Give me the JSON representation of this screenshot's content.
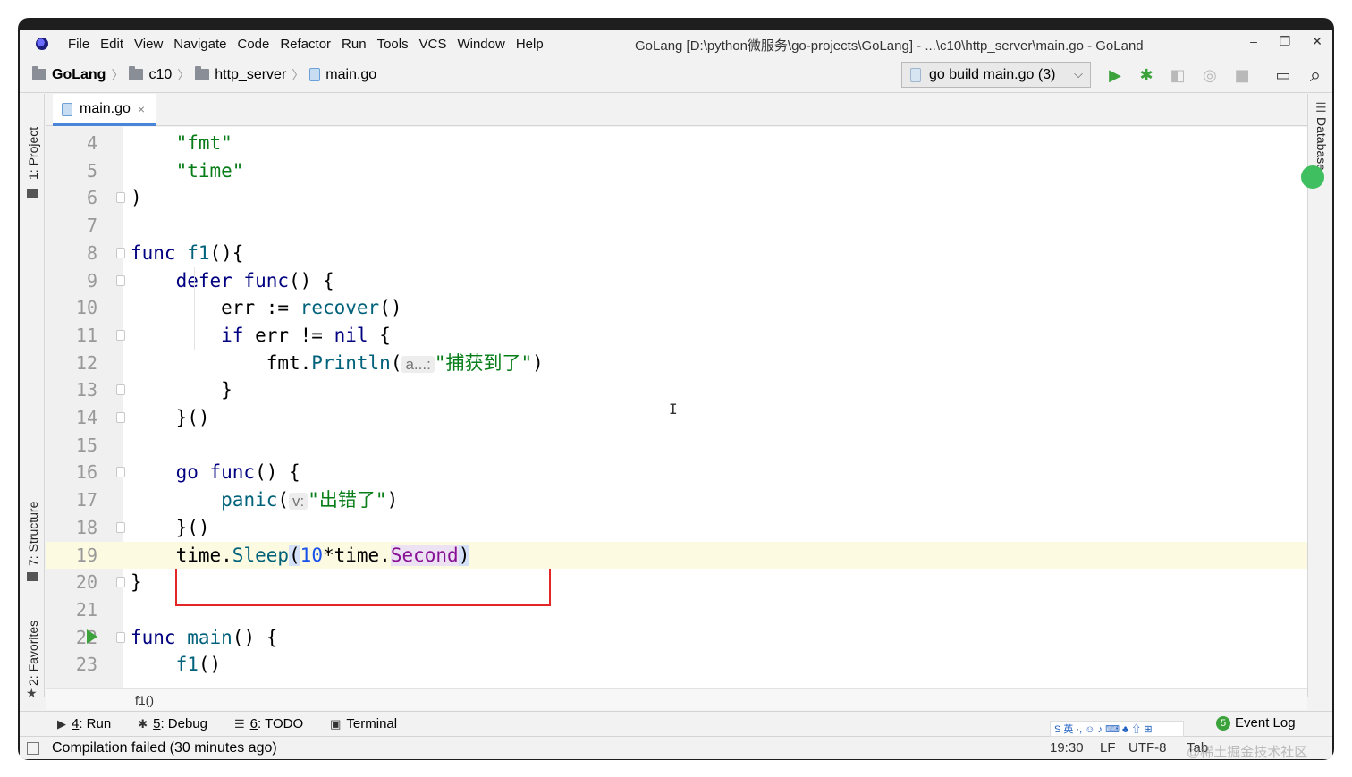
{
  "window": {
    "title": "GoLang [D:\\python微服务\\go-projects\\GoLang] - ...\\c10\\http_server\\main.go - GoLand",
    "minimize": "–",
    "maximize": "❐",
    "close": "✕"
  },
  "menu": [
    "File",
    "Edit",
    "View",
    "Navigate",
    "Code",
    "Refactor",
    "Run",
    "Tools",
    "VCS",
    "Window",
    "Help"
  ],
  "breadcrumbs": [
    {
      "label": "GoLang",
      "icon": "folder-icon"
    },
    {
      "label": "c10",
      "icon": "folder-icon"
    },
    {
      "label": "http_server",
      "icon": "folder-icon"
    },
    {
      "label": "main.go",
      "icon": "go-file-icon"
    }
  ],
  "run_config": {
    "label": "go build main.go (3)"
  },
  "toolbar_icons": {
    "run": "▶",
    "debug": "✱",
    "coverage": "◧",
    "profile": "◎",
    "stop": "■",
    "terminal_toggle": "▭",
    "search": "⌕"
  },
  "colors": {
    "run": "#3ca23c",
    "debug": "#3ca23c",
    "disabled": "#b9b9b9",
    "highlight_box": "#e32626"
  },
  "left_tools": {
    "project": "1: Project",
    "structure": "7: Structure",
    "favorites": "2: Favorites"
  },
  "right_tools": {
    "database": "Database"
  },
  "editor_tab": {
    "label": "main.go",
    "close": "×"
  },
  "code_lines": [
    {
      "n": "4",
      "parts": [
        [
          "pad",
          "    "
        ],
        [
          "str",
          "\"fmt\""
        ]
      ]
    },
    {
      "n": "5",
      "parts": [
        [
          "pad",
          "    "
        ],
        [
          "str",
          "\"time\""
        ]
      ]
    },
    {
      "n": "6",
      "parts": [
        [
          "pkg",
          ")"
        ]
      ]
    },
    {
      "n": "7",
      "parts": []
    },
    {
      "n": "8",
      "parts": [
        [
          "kw",
          "func "
        ],
        [
          "fn",
          "f1"
        ],
        [
          "pkg",
          "(){"
        ]
      ]
    },
    {
      "n": "9",
      "parts": [
        [
          "pad",
          "    "
        ],
        [
          "kw",
          "defer func"
        ],
        [
          "pkg",
          "() {"
        ]
      ]
    },
    {
      "n": "10",
      "parts": [
        [
          "pad",
          "        "
        ],
        [
          "pkg",
          "err := "
        ],
        [
          "fn",
          "recover"
        ],
        [
          "pkg",
          "()"
        ]
      ]
    },
    {
      "n": "11",
      "parts": [
        [
          "pad",
          "        "
        ],
        [
          "kw",
          "if "
        ],
        [
          "pkg",
          "err != "
        ],
        [
          "kw",
          "nil"
        ],
        [
          "pkg",
          " {"
        ]
      ]
    },
    {
      "n": "12",
      "parts": [
        [
          "pad",
          "            "
        ],
        [
          "pkg",
          "fmt."
        ],
        [
          "fn",
          "Println"
        ],
        [
          "pkg",
          "("
        ],
        [
          "hint",
          "a...:"
        ],
        [
          "str",
          "\"捕获到了\""
        ],
        [
          "pkg",
          ")"
        ]
      ]
    },
    {
      "n": "13",
      "parts": [
        [
          "pad",
          "        "
        ],
        [
          "pkg",
          "}"
        ]
      ]
    },
    {
      "n": "14",
      "parts": [
        [
          "pad",
          "    "
        ],
        [
          "pkg",
          "}()"
        ]
      ]
    },
    {
      "n": "15",
      "parts": []
    },
    {
      "n": "16",
      "parts": [
        [
          "pad",
          "    "
        ],
        [
          "kw",
          "go func"
        ],
        [
          "pkg",
          "() {"
        ]
      ]
    },
    {
      "n": "17",
      "parts": [
        [
          "pad",
          "        "
        ],
        [
          "fn",
          "panic"
        ],
        [
          "pkg",
          "("
        ],
        [
          "hint",
          "v:"
        ],
        [
          "str",
          "\"出错了\""
        ],
        [
          "pkg",
          ")"
        ]
      ]
    },
    {
      "n": "18",
      "parts": [
        [
          "pad",
          "    "
        ],
        [
          "pkg",
          "}()"
        ]
      ]
    },
    {
      "n": "19",
      "current": true,
      "parts": [
        [
          "pad",
          "    "
        ],
        [
          "pkg",
          "time."
        ],
        [
          "fn",
          "Sleep"
        ],
        [
          "bm",
          "("
        ],
        [
          "num",
          "10"
        ],
        [
          "pkg",
          "*time."
        ],
        [
          "sf",
          "Second"
        ],
        [
          "bm",
          ")"
        ]
      ]
    },
    {
      "n": "20",
      "parts": [
        [
          "pkg",
          "}"
        ]
      ]
    },
    {
      "n": "21",
      "parts": []
    },
    {
      "n": "22",
      "run": true,
      "parts": [
        [
          "kw",
          "func "
        ],
        [
          "fn",
          "main"
        ],
        [
          "pkg",
          "() {"
        ]
      ]
    },
    {
      "n": "23",
      "parts": [
        [
          "pad",
          "    "
        ],
        [
          "fn",
          "f1"
        ],
        [
          "pkg",
          "()"
        ]
      ]
    }
  ],
  "code_breadcrumb": "f1()",
  "bottom_tabs": [
    {
      "icon": "▶",
      "key": "4",
      "label": ": Run"
    },
    {
      "icon": "✱",
      "key": "5",
      "label": ": Debug"
    },
    {
      "icon": "☰",
      "key": "6",
      "label": ": TODO"
    },
    {
      "icon": "▣",
      "key": "",
      "label": "Terminal"
    }
  ],
  "event_log": {
    "badge": "5",
    "label": "Event Log"
  },
  "status": {
    "message": "Compilation failed (30 minutes ago)",
    "position": "19:30",
    "line_sep": "LF",
    "encoding": "UTF-8",
    "indent": "Tab"
  },
  "ime": {
    "label": "S 英 ·, ☺ ♪ ⌨ ♣ ⇧ ⊞"
  },
  "watermark": "@稀土掘金技术社区"
}
